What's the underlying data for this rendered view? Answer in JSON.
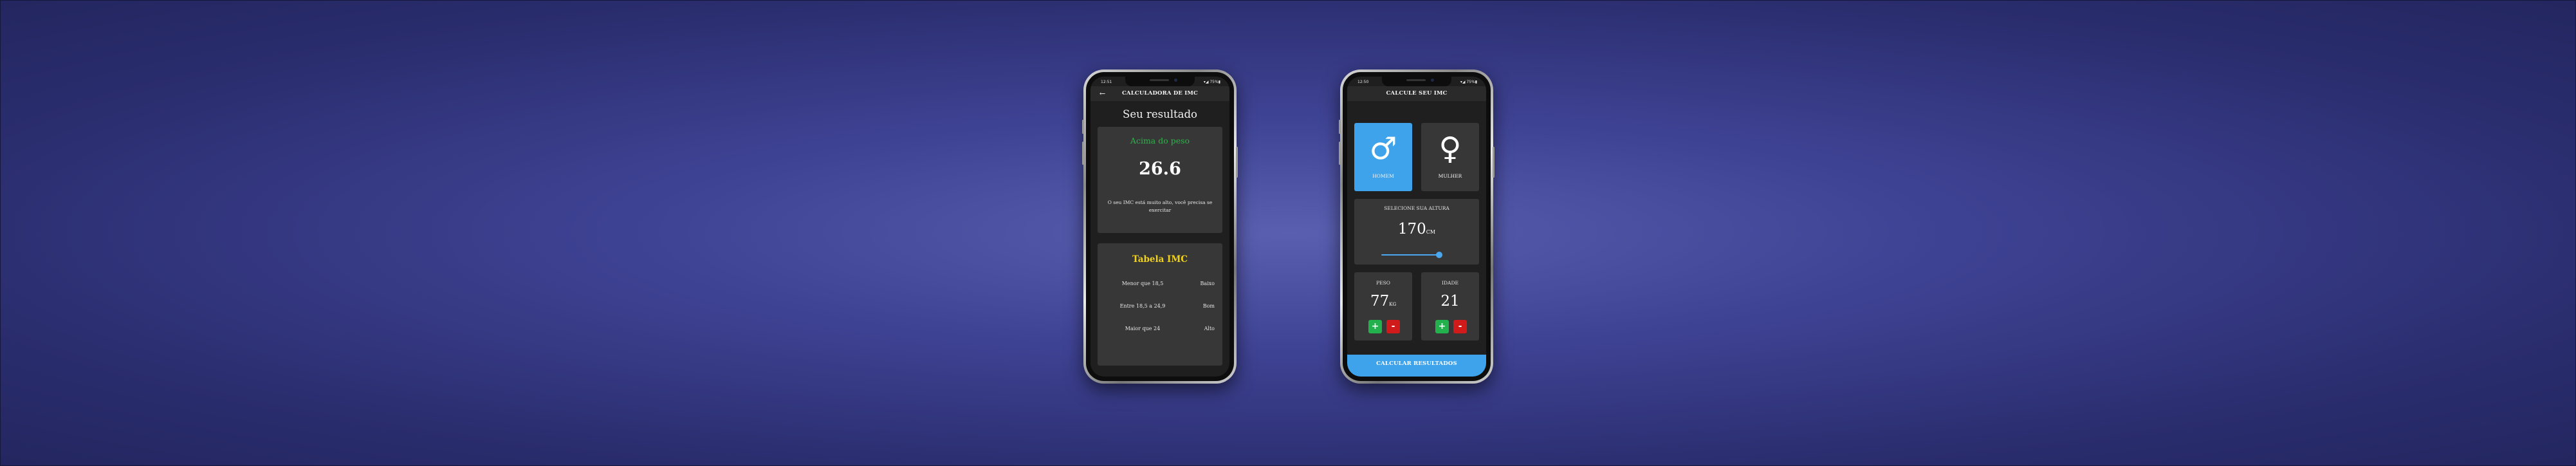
{
  "background": {
    "color_center": "#5a5fb0",
    "color_edge": "#23265f"
  },
  "result_screen": {
    "status_time": "12:51",
    "status_icons": "▾◢ 75%▮",
    "app_title": "CALCULADORA DE IMC",
    "back_icon": "arrow-left-icon",
    "heading": "Seu resultado",
    "result": {
      "status": "Acima do peso",
      "status_color": "#2db34a",
      "value": "26.6",
      "message": "O seu IMC está muito alto, você precisa se exercitar"
    },
    "table": {
      "title": "Tabela IMC",
      "rows": [
        {
          "range": "Menor que 18,5",
          "label": "Baixo"
        },
        {
          "range": "Entre 18,5 a 24,9",
          "label": "Bom"
        },
        {
          "range": "Maior que 24",
          "label": "Alto"
        }
      ]
    }
  },
  "calculator_screen": {
    "status_time": "12:50",
    "status_icons": "▾◢ 75%▮",
    "app_title": "CALCULE SEU IMC",
    "gender": {
      "male": {
        "symbol": "♂",
        "label": "HOMEM",
        "selected": true
      },
      "female": {
        "symbol": "♀",
        "label": "MULHER",
        "selected": false
      }
    },
    "height": {
      "title": "SELECIONE SUA ALTURA",
      "value": "170",
      "unit": "CM"
    },
    "weight": {
      "title": "PESO",
      "value": "77",
      "unit": "KG",
      "plus": "+",
      "minus": "-"
    },
    "age": {
      "title": "IDADE",
      "value": "21",
      "plus": "+",
      "minus": "-"
    },
    "calculate_button": "CALCULAR RESULTADOS",
    "accent_color": "#3ea3ea"
  }
}
